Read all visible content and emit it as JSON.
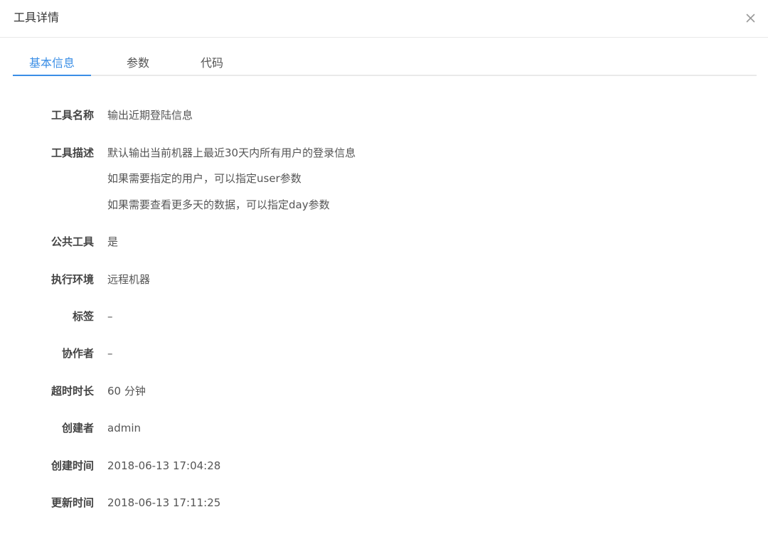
{
  "dialog": {
    "title": "工具详情",
    "close_icon": "close-icon"
  },
  "tabs": [
    {
      "label": "基本信息",
      "active": true
    },
    {
      "label": "参数",
      "active": false
    },
    {
      "label": "代码",
      "active": false
    }
  ],
  "accent_color": "#3a8ee6",
  "fields": {
    "name": {
      "label": "工具名称",
      "value": "输出近期登陆信息"
    },
    "description": {
      "label": "工具描述",
      "lines": [
        "默认输出当前机器上最近30天内所有用户的登录信息",
        "如果需要指定的用户，可以指定user参数",
        "如果需要查看更多天的数据，可以指定day参数"
      ]
    },
    "public": {
      "label": "公共工具",
      "value": "是"
    },
    "environment": {
      "label": "执行环境",
      "value": "远程机器"
    },
    "tags": {
      "label": "标签",
      "value": "–"
    },
    "collaborators": {
      "label": "协作者",
      "value": "–"
    },
    "timeout": {
      "label": "超时时长",
      "value": "60 分钟"
    },
    "creator": {
      "label": "创建者",
      "value": "admin"
    },
    "created_at": {
      "label": "创建时间",
      "value": "2018-06-13 17:04:28"
    },
    "updated_at": {
      "label": "更新时间",
      "value": "2018-06-13 17:11:25"
    }
  }
}
